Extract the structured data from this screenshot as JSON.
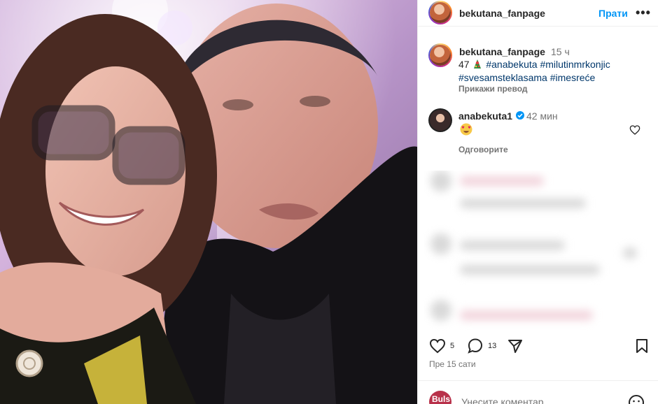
{
  "post": {
    "photo_alt": "Selfie photo"
  },
  "header": {
    "username": "bekutana_fanpage",
    "follow_label": "Прати",
    "more_label": "•••"
  },
  "caption": {
    "username": "bekutana_fanpage",
    "time": "15 ч",
    "prefix": "47",
    "hashtags": [
      "#anabekuta",
      "#milutinmrkonjic",
      "#svesamsteklasama",
      "#imesreće"
    ],
    "translate_label": "Прикажи превод"
  },
  "comment": {
    "username": "anabekuta1",
    "time": "42 мин",
    "reply_label": "Одговорите",
    "emoji": "😍"
  },
  "actions": {
    "like_count": "5",
    "comment_count": "13"
  },
  "time_ago": "Пре 15 сати",
  "comment_bar": {
    "placeholder": "Унесите коментар",
    "avatar_text": "Buls"
  },
  "colors": {
    "accent": "#0095f6",
    "hashtag": "#00376b",
    "muted": "#737373"
  }
}
